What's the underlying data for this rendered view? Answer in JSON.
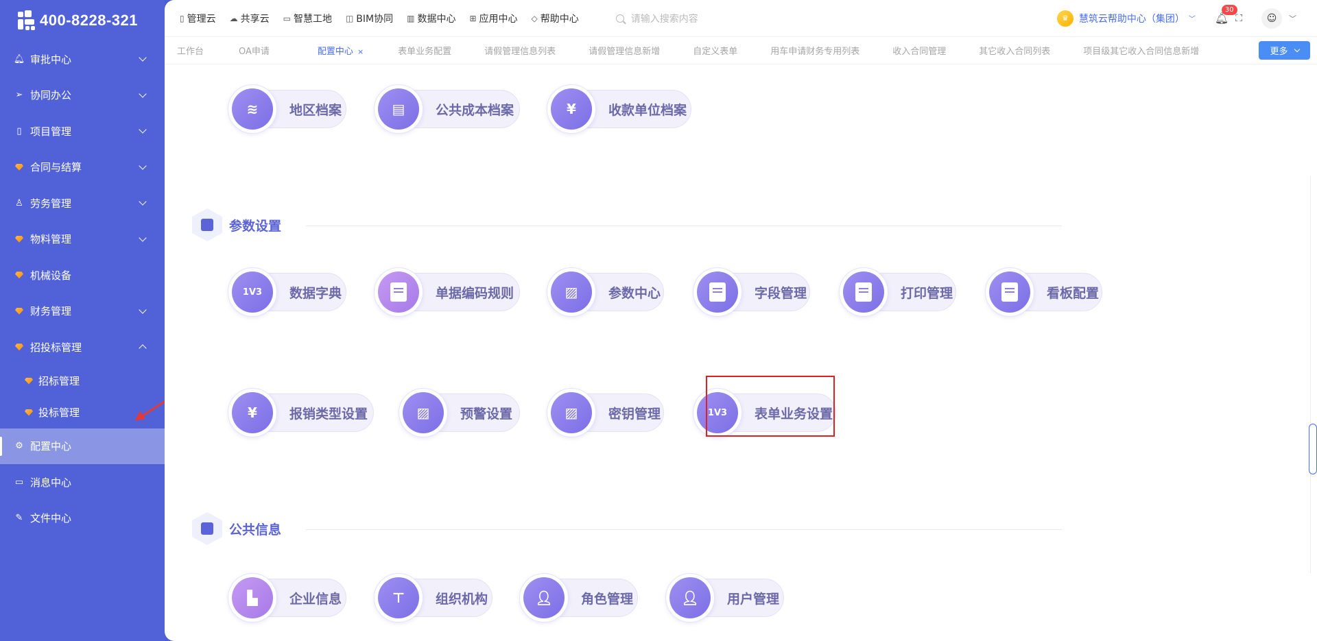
{
  "logo": {
    "text": "400-8228-321"
  },
  "sidebar": {
    "items": [
      {
        "label": "审批中心",
        "icon": "bell-icon"
      },
      {
        "label": "协同办公",
        "icon": "send-icon"
      },
      {
        "label": "项目管理",
        "icon": "book-icon"
      },
      {
        "label": "合同与结算",
        "icon": "gem-icon"
      },
      {
        "label": "劳务管理",
        "icon": "user-stamp-icon"
      },
      {
        "label": "物料管理",
        "icon": "gem-icon"
      },
      {
        "label": "机械设备",
        "icon": "gem-icon"
      },
      {
        "label": "财务管理",
        "icon": "gem-icon"
      },
      {
        "label": "招投标管理",
        "icon": "gem-icon"
      }
    ],
    "sub_items": [
      {
        "label": "招标管理"
      },
      {
        "label": "投标管理"
      }
    ],
    "bottom_items": [
      {
        "label": "配置中心",
        "icon": "gear-icon"
      },
      {
        "label": "消息中心",
        "icon": "chat-icon"
      },
      {
        "label": "文件中心",
        "icon": "edit-doc-icon"
      }
    ]
  },
  "topbar": {
    "links": [
      "管理云",
      "共享云",
      "智慧工地",
      "BIM协同",
      "数据中心",
      "应用中心",
      "帮助中心"
    ],
    "search_placeholder": "请输入搜索内容",
    "help_center": "慧筑云帮助中心（集团）",
    "notification_count": "30"
  },
  "tabs": [
    "工作台",
    "OA申请",
    "配置中心",
    "表单业务配置",
    "请假管理信息列表",
    "请假管理信息新增",
    "自定义表单",
    "用车申请财务专用列表",
    "收入合同管理",
    "其它收入合同列表",
    "项目级其它收入合同信息新增"
  ],
  "tab_close": "×",
  "more_label": "更多",
  "section_top": {
    "cards": [
      "地区档案",
      "公共成本档案",
      "收款单位档案"
    ]
  },
  "section_params": {
    "title": "参数设置",
    "row1": [
      "数据字典",
      "单据编码规则",
      "参数中心",
      "字段管理",
      "打印管理",
      "看板配置"
    ],
    "row2": [
      "报销类型设置",
      "预警设置",
      "密钥管理",
      "表单业务设置"
    ]
  },
  "section_public": {
    "title": "公共信息",
    "cards": [
      "企业信息",
      "组织机构",
      "角色管理",
      "用户管理"
    ]
  },
  "colors": {
    "sidebar": "#5162d9",
    "accent": "#4a6ef5",
    "highlight": "#e02020"
  }
}
